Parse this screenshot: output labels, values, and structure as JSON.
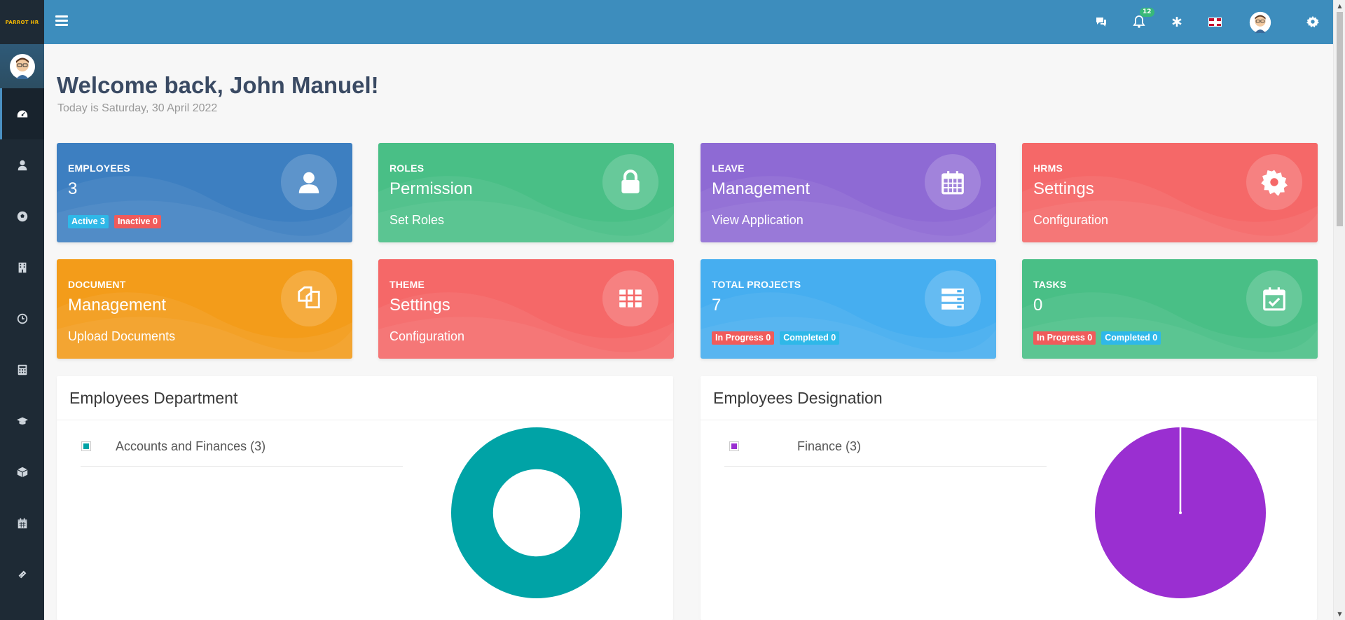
{
  "brand": {
    "logo_text": "PARROT HR"
  },
  "topbar": {
    "notification_count": "12"
  },
  "welcome": {
    "title": "Welcome back, John Manuel!",
    "date": "Today is Saturday, 30 April 2022"
  },
  "cards": [
    {
      "label": "EMPLOYEES",
      "value": "3",
      "badges": [
        "Active 3",
        "Inactive 0"
      ],
      "color": "#3d7fc1",
      "icon": "user-icon"
    },
    {
      "label": "ROLES",
      "value": "Permission",
      "sub": "Set Roles",
      "color": "#49bf86",
      "icon": "lock-icon"
    },
    {
      "label": "LEAVE",
      "value": "Management",
      "sub": "View Application",
      "color": "#8e6ad4",
      "icon": "calendar-icon"
    },
    {
      "label": "HRMS",
      "value": "Settings",
      "sub": "Configuration",
      "color": "#f56868",
      "icon": "gear-icon"
    },
    {
      "label": "DOCUMENT",
      "value": "Management",
      "sub": "Upload Documents",
      "color": "#f39c1a",
      "icon": "documents-icon"
    },
    {
      "label": "THEME",
      "value": "Settings",
      "sub": "Configuration",
      "color": "#f56868",
      "icon": "table-icon"
    },
    {
      "label": "TOTAL PROJECTS",
      "value": "7",
      "badges": [
        "In Progress 0",
        "Completed 0"
      ],
      "color": "#46aef0",
      "icon": "server-icon"
    },
    {
      "label": "TASKS",
      "value": "0",
      "badges": [
        "In Progress 0",
        "Completed 0"
      ],
      "color": "#49bf86",
      "icon": "calendar-check-icon"
    }
  ],
  "panels": {
    "department": {
      "title": "Employees Department",
      "legend": "Accounts and Finances (3)",
      "color": "#00a3a6"
    },
    "designation": {
      "title": "Employees Designation",
      "legend": "Finance (3)",
      "color": "#9a2fd1"
    }
  },
  "chart_data": [
    {
      "type": "pie",
      "categories": [
        "Accounts and Finances"
      ],
      "values": [
        3
      ],
      "donut": true
    },
    {
      "type": "pie",
      "categories": [
        "Finance"
      ],
      "values": [
        3
      ],
      "donut": false
    }
  ]
}
